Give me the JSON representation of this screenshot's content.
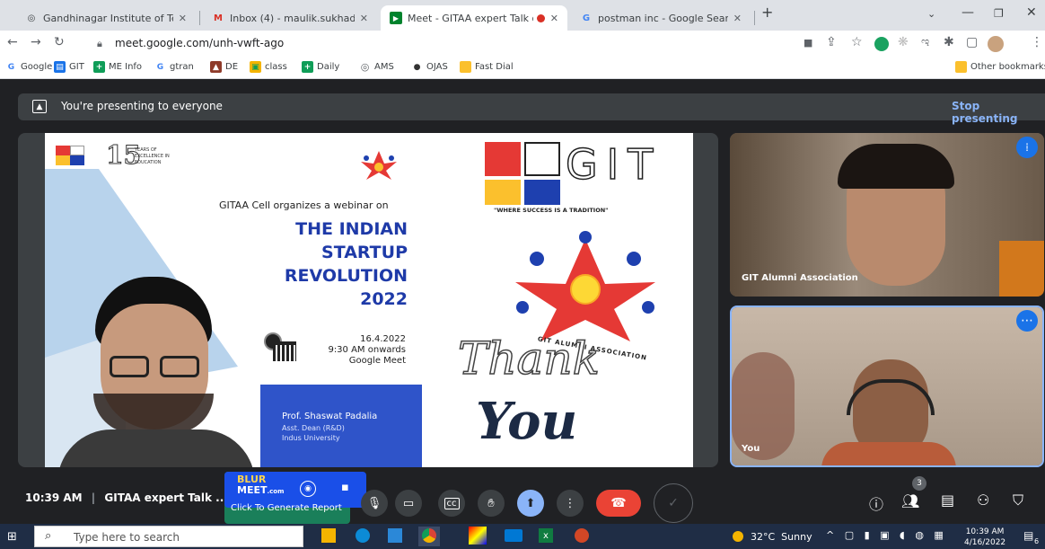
{
  "browser": {
    "tabs": [
      {
        "title": "Gandhinagar Institute of Technol",
        "icon": "globe-icon"
      },
      {
        "title": "Inbox (4) - maulik.sukhadiya@git",
        "icon": "gmail-icon"
      },
      {
        "title": "Meet - GITAA expert Talk on",
        "icon": "meet-icon"
      },
      {
        "title": "postman inc - Google Search",
        "icon": "google-icon"
      }
    ],
    "url": "meet.google.com/unh-vwft-ago",
    "bookmarks": [
      "Google",
      "GIT",
      "ME Info",
      "gtran",
      "DE",
      "class",
      "Daily",
      "AMS",
      "OJAS",
      "Fast Dial"
    ],
    "other_bookmarks": "Other bookmarks"
  },
  "meet": {
    "presenting_text": "You're presenting to everyone",
    "stop_presenting": "Stop presenting",
    "participants": [
      {
        "name": "GIT Alumni Association"
      },
      {
        "name": "You"
      }
    ],
    "time": "10:39 AM",
    "meeting_title": "GITAA expert Talk ...",
    "people_count": "3"
  },
  "slide": {
    "years_number": "15",
    "years_text": "YEARS OF",
    "excellence_text": "EXCELLENCE IN",
    "education_text": "EDUCATION",
    "intro": "GITAA Cell organizes a webinar on",
    "title_lines": [
      "THE INDIAN",
      "STARTUP",
      "REVOLUTION",
      "2022"
    ],
    "date": "16.4.2022",
    "time": "9:30 AM onwards",
    "platform": "Google Meet",
    "speaker_name": "Prof. Shaswat Padalia",
    "speaker_title": "Asst. Dean (R&D)",
    "speaker_org": "Indus University",
    "git_logo": "GIT",
    "tagline": "\"WHERE SUCCESS IS A TRADITION\"",
    "association": "GIT ALUMNI ASSOCIATION",
    "thank": "Thank",
    "you": "You"
  },
  "blurmeet": {
    "brand_top": "BLUR",
    "brand_bottom": "MEET",
    "brand_suffix": ".com",
    "report": "Click To Generate Report"
  },
  "taskbar": {
    "search_placeholder": "Type here to search",
    "weather": "32°C  Sunny",
    "time": "10:39 AM",
    "date": "4/16/2022",
    "notif": "6"
  }
}
